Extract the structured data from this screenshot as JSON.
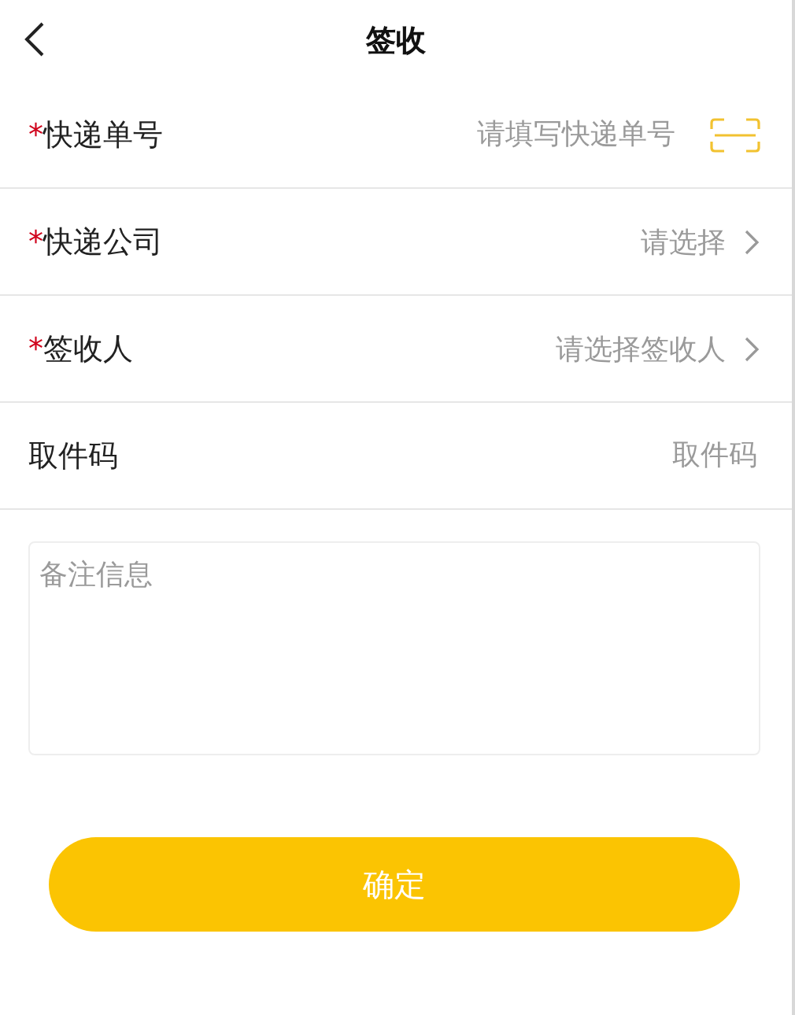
{
  "header": {
    "title": "签收"
  },
  "rows": [
    {
      "kind": "input",
      "mark": "*",
      "label": "快递单号",
      "placeholder": "请填写快递单号",
      "scan": true
    },
    {
      "kind": "select",
      "mark": "*",
      "label": "快递公司",
      "placeholder": "请选择"
    },
    {
      "kind": "select",
      "mark": "*",
      "label": "签收人",
      "placeholder": "请选择签收人"
    },
    {
      "kind": "input",
      "label": "取件码",
      "placeholder": "取件码",
      "scan": false
    }
  ],
  "remarks": {
    "placeholder": "备注信息"
  },
  "submit": {
    "label": "确定"
  }
}
